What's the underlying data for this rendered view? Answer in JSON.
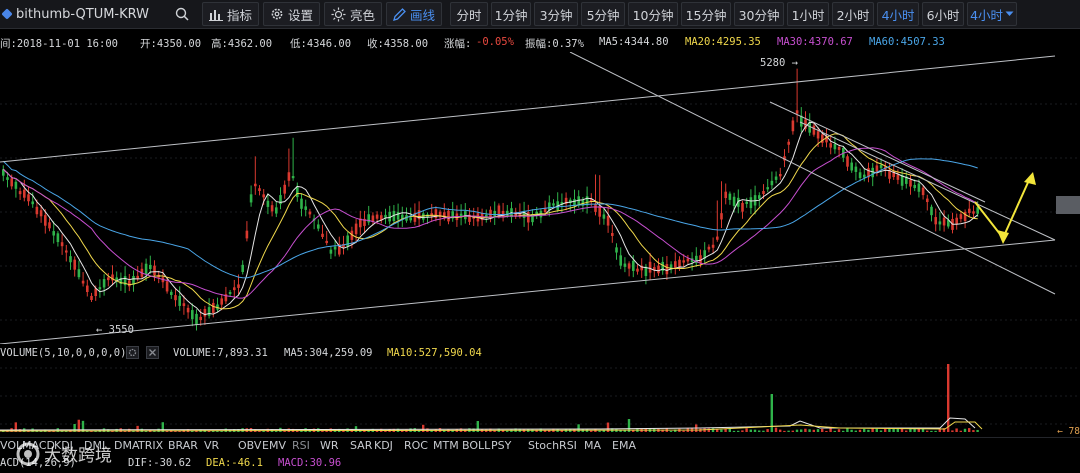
{
  "toolbar": {
    "symbol": "bithumb-QTUM-KRW",
    "buttons": [
      {
        "label": "指标",
        "icon": "bar-chart-icon"
      },
      {
        "label": "设置",
        "icon": "gear-icon"
      },
      {
        "label": "亮色",
        "icon": "sun-icon"
      },
      {
        "label": "画线",
        "icon": "pencil-icon"
      }
    ],
    "periods": [
      "分时",
      "1分钟",
      "3分钟",
      "5分钟",
      "10分钟",
      "15分钟",
      "30分钟",
      "1小时",
      "2小时",
      "4小时",
      "6小时"
    ],
    "active_period": "4小时",
    "period_dropdown": "4小时",
    "active_color": "#4a8ff0"
  },
  "info": {
    "time": "间:2018-11-01 16:00",
    "open": "开:4350.00",
    "high": "高:4362.00",
    "low": "低:4346.00",
    "close": "收:4358.00",
    "change_label": "涨幅:",
    "change_value": "-0.05%",
    "amplitude": "振幅:0.37%",
    "ma5": "MA5:4344.80",
    "ma20": "MA20:4295.35",
    "ma30": "MA30:4370.67",
    "ma60": "MA60:4507.33"
  },
  "annotations": {
    "high": "5280 →",
    "low": "← 3550"
  },
  "volume": {
    "title": "VOLUME(5,10,0,0,0,0)",
    "value": "VOLUME:7,893.31",
    "ma5": "MA5:304,259.09",
    "ma10": "MA10:527,590.04",
    "right_tag": "← 78"
  },
  "indicators": [
    "VOL",
    "MACD",
    "KDJ",
    "DMI",
    "DMA",
    "TRIX",
    "BRAR",
    "VR",
    "OBV",
    "EMV",
    "RSI",
    "WR",
    "SAR",
    "KDJ",
    "ROC",
    "MTM",
    "BOLL",
    "PSY",
    "StochRSI",
    "MA",
    "EMA"
  ],
  "active_indicator": "RSI",
  "macd": {
    "title": "ACD(14,26,9)",
    "dif": "DIF:-30.62",
    "dea": "DEA:-46.1",
    "macd": "MACD:30.96"
  },
  "watermark": "大数跨境",
  "colors": {
    "up": "#2fb34a",
    "down": "#d9392f",
    "ma5": "#e6e6e6",
    "ma20": "#f0d84c",
    "ma30": "#c64fcf",
    "ma60": "#4aa6e8",
    "trend_arrow": "#f2e53a"
  }
}
